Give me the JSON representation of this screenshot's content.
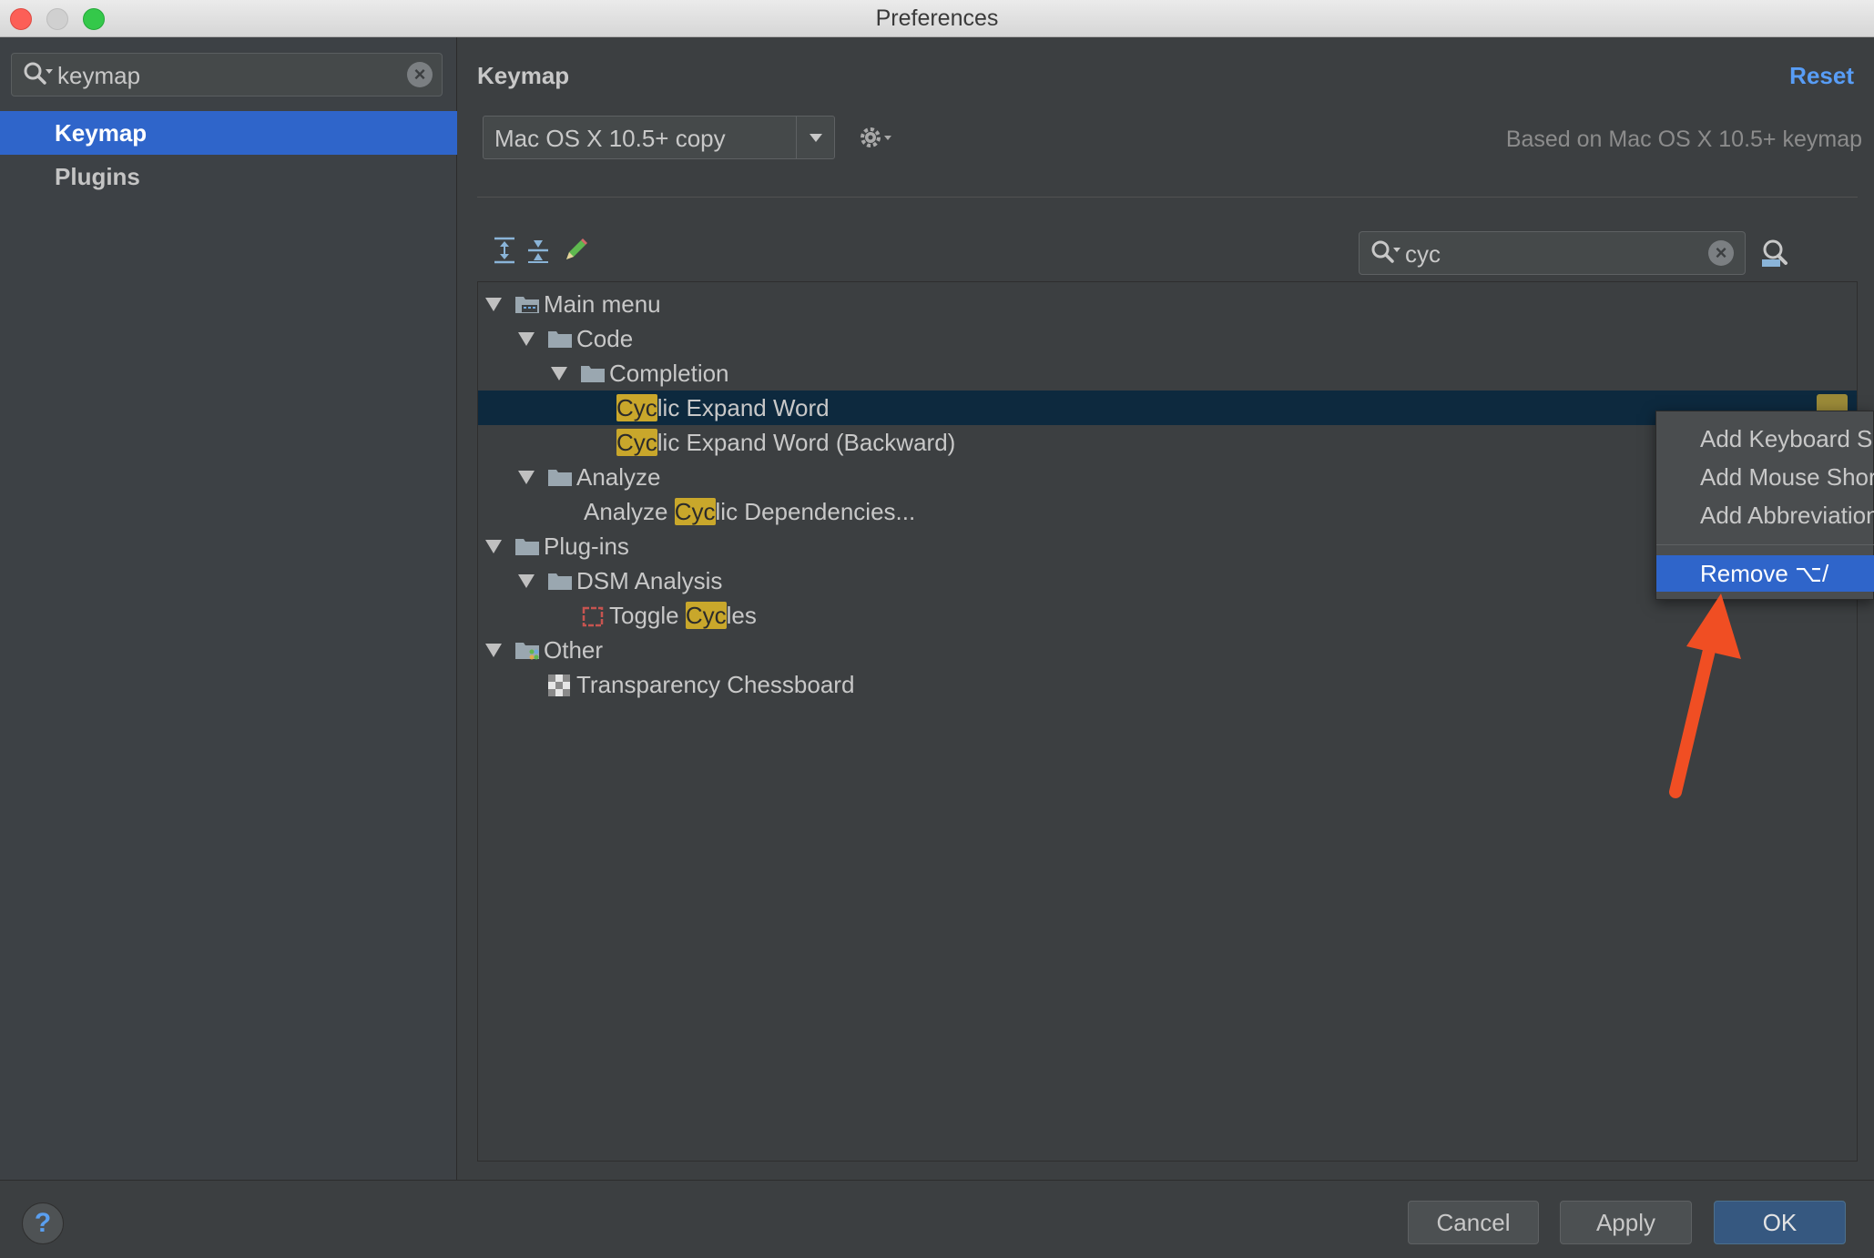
{
  "window": {
    "title": "Preferences"
  },
  "sidebar": {
    "search": {
      "value": "keymap"
    },
    "items": [
      {
        "label": "Keymap",
        "active": true
      },
      {
        "label": "Plugins",
        "active": false
      }
    ]
  },
  "main": {
    "heading": "Keymap",
    "reset_label": "Reset",
    "keymap_select": {
      "value": "Mac OS X 10.5+ copy"
    },
    "based_on": "Based on Mac OS X 10.5+ keymap",
    "filter": {
      "value": "cyc"
    },
    "tree": [
      {
        "label": "Main menu",
        "type": "menu-folder",
        "level": 0,
        "expanded": true
      },
      {
        "label": "Code",
        "type": "folder",
        "level": 1,
        "expanded": true
      },
      {
        "label": "Completion",
        "type": "folder",
        "level": 2,
        "expanded": true
      },
      {
        "pre": "",
        "hl": "Cyc",
        "post": "lic Expand Word",
        "type": "action",
        "level": 3,
        "selected": true
      },
      {
        "pre": "",
        "hl": "Cyc",
        "post": "lic Expand Word (Backward)",
        "type": "action",
        "level": 3
      },
      {
        "label": "Analyze",
        "type": "folder",
        "level": 1,
        "expanded": true
      },
      {
        "pre": "Analyze ",
        "hl": "Cyc",
        "post": "lic Dependencies...",
        "type": "action",
        "level": 2
      },
      {
        "label": "Plug-ins",
        "type": "folder",
        "level": 0,
        "expanded": true
      },
      {
        "label": "DSM Analysis",
        "type": "folder",
        "level": 1,
        "expanded": true
      },
      {
        "pre": "Toggle ",
        "hl": "Cyc",
        "post": "les",
        "type": "action-icon",
        "level": 2
      },
      {
        "label": "Other",
        "type": "other-folder",
        "level": 0,
        "expanded": true
      },
      {
        "label": "Transparency Chessboard",
        "type": "chess-action",
        "level": 1
      }
    ]
  },
  "context_menu": {
    "items": [
      {
        "label": "Add Keyboard Shortcut"
      },
      {
        "label": "Add Mouse Shortcut"
      },
      {
        "label": "Add Abbreviation"
      }
    ],
    "remove": {
      "label": "Remove ⌥/"
    }
  },
  "footer": {
    "help": "?",
    "cancel": "Cancel",
    "apply": "Apply",
    "ok": "OK"
  },
  "colors": {
    "accent": "#2f65ca",
    "highlight": "#c9a72b",
    "link": "#589df6",
    "arrow": "#f04e23"
  }
}
